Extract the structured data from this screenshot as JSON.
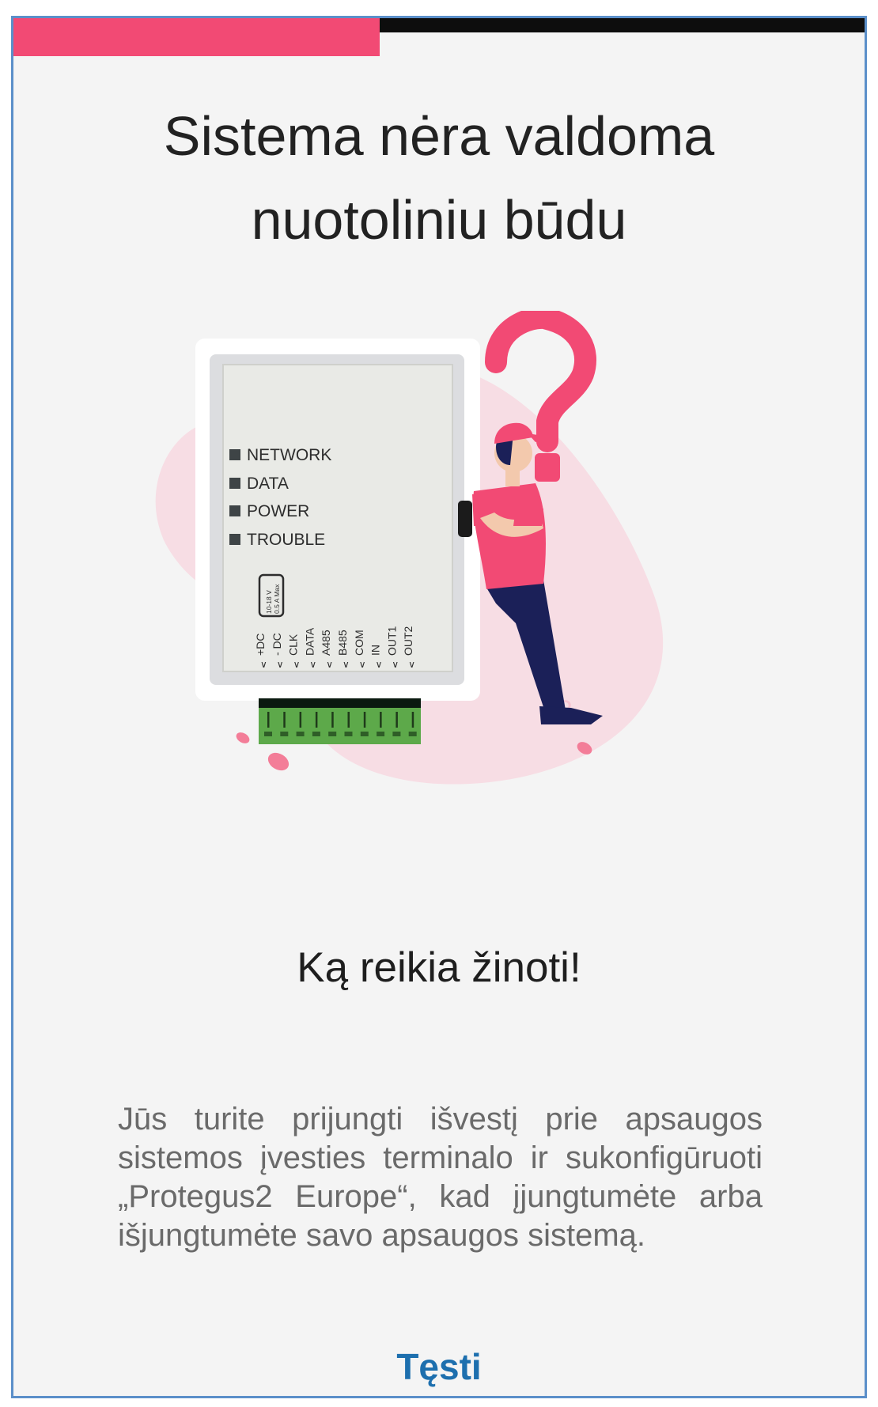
{
  "progress": {
    "fraction": 0.43,
    "fill_color": "#f24a74",
    "track_color": "#0d0d0d"
  },
  "title": {
    "line1": "Sistema nėra valdoma",
    "line2": "nuotoliniu būdu"
  },
  "illustration": {
    "icon": "confused-person-device-illustration",
    "indicators": [
      "NETWORK",
      "DATA",
      "POWER",
      "TROUBLE"
    ],
    "power_rating": {
      "line1": "10-18 V",
      "line2": "0.5 A Max"
    },
    "terminals": [
      "+DC",
      "- DC",
      "CLK",
      "DATA",
      "A485",
      "B485",
      "COM",
      "IN",
      "OUT1",
      "OUT2"
    ],
    "accent_color": "#f24a74"
  },
  "subtitle": "Ką reikia žinoti!",
  "description": "Jūs turite prijungti išvestį prie apsaugos sistemos įvesties terminalo ir sukonfigūruoti „Protegus2 Europe“, kad įjungtumėte arba išjungtumėte savo apsaugos sistemą.",
  "continue_button": {
    "label": "Tęsti",
    "color": "#1d6fae"
  }
}
